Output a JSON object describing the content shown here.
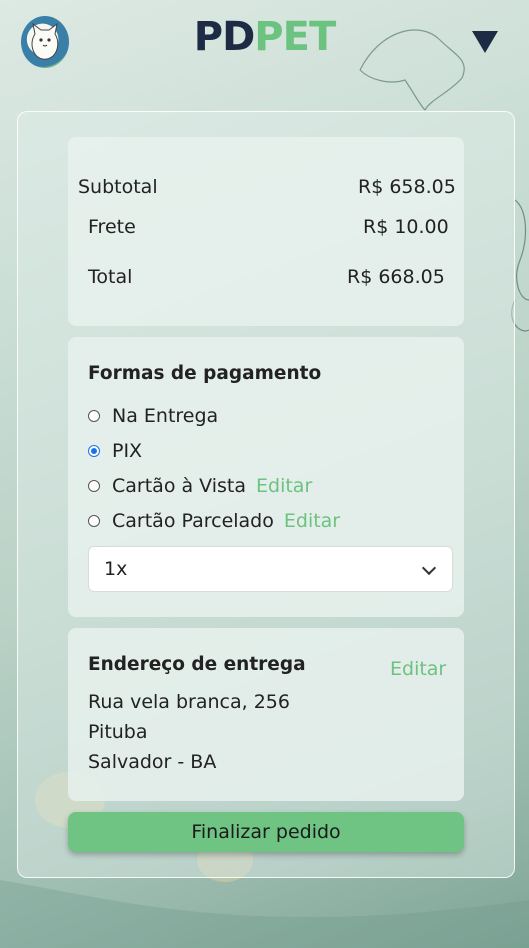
{
  "header": {
    "brand_pd": "PD",
    "brand_pet": "PET"
  },
  "summary": {
    "subtotal_label": "Subtotal",
    "subtotal_value": "R$ 658.05",
    "shipping_label": "Frete",
    "shipping_value": "R$ 10.00",
    "total_label": "Total",
    "total_value": "R$ 668.05"
  },
  "payment": {
    "title": "Formas de pagamento",
    "options": [
      {
        "label": "Na Entrega",
        "checked": false
      },
      {
        "label": "PIX",
        "checked": true
      },
      {
        "label": "Cartão à Vista",
        "checked": false,
        "edit": "Editar"
      },
      {
        "label": "Cartão Parcelado",
        "checked": false,
        "edit": "Editar"
      }
    ],
    "installments_selected": "1x"
  },
  "address": {
    "title": "Endereço de entrega",
    "edit": "Editar",
    "street": "Rua vela branca, 256",
    "district": "Pituba",
    "city": "Salvador - BA"
  },
  "actions": {
    "finish_label": "Finalizar pedido"
  },
  "colors": {
    "brand_dark": "#1d2b45",
    "brand_green": "#6cc27f",
    "button_green": "#6fc383",
    "radio_selected": "#1a73e8"
  },
  "icons": [
    "cat-logo-icon",
    "menu-triangle-icon",
    "chevron-down-icon"
  ]
}
